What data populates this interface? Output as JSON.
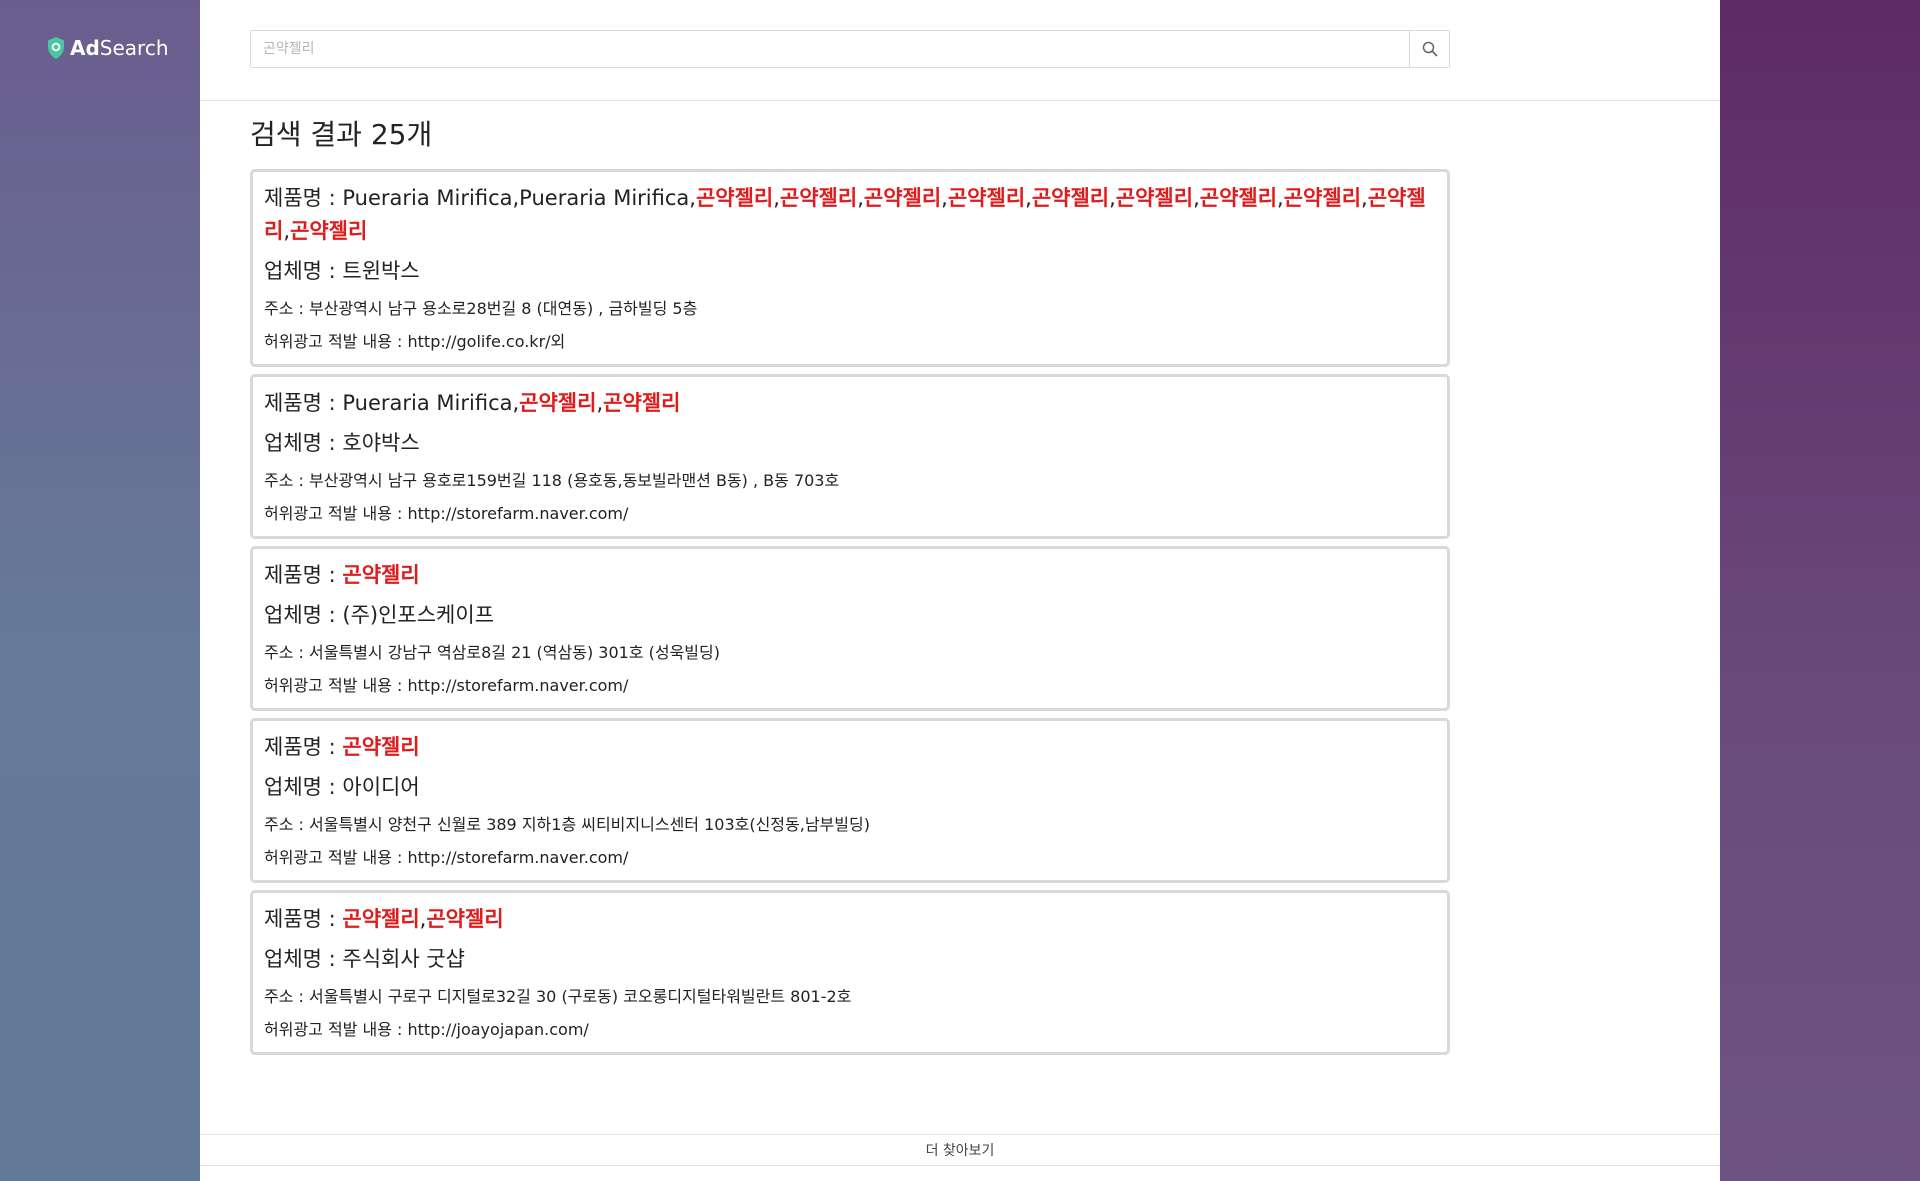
{
  "brand": {
    "name_bold": "Ad",
    "name_rest": "Search",
    "logo_icon": "shield-icon",
    "logo_color": "#4cc5a0"
  },
  "search": {
    "placeholder": "곤약젤리",
    "value": "",
    "button_icon": "search-icon"
  },
  "results_header": "검색 결과 25개",
  "labels": {
    "product": "제품명 : ",
    "company": "업체명 : ",
    "address": "주소 : ",
    "violation": "허위광고 적발 내용 : "
  },
  "results": [
    {
      "product_parts": [
        {
          "text": "Pueraria Mirifica,Pueraria Mirifica,",
          "hl": false
        },
        {
          "text": "곤약젤리",
          "hl": true
        },
        {
          "text": ",",
          "hl": false
        },
        {
          "text": "곤약젤리",
          "hl": true
        },
        {
          "text": ",",
          "hl": false
        },
        {
          "text": "곤약젤리",
          "hl": true
        },
        {
          "text": ",",
          "hl": false
        },
        {
          "text": "곤약젤리",
          "hl": true
        },
        {
          "text": ",",
          "hl": false
        },
        {
          "text": "곤약젤리",
          "hl": true
        },
        {
          "text": ",",
          "hl": false
        },
        {
          "text": "곤약젤리",
          "hl": true
        },
        {
          "text": ",",
          "hl": false
        },
        {
          "text": "곤약젤리",
          "hl": true
        },
        {
          "text": ",",
          "hl": false
        },
        {
          "text": "곤약젤리",
          "hl": true
        },
        {
          "text": ",",
          "hl": false
        },
        {
          "text": "곤약젤리",
          "hl": true
        },
        {
          "text": ",",
          "hl": false
        },
        {
          "text": "곤약젤리",
          "hl": true
        }
      ],
      "company": "트윈박스",
      "address": "부산광역시 남구 용소로28번길 8 (대연동) , 금하빌딩 5층",
      "violation": "http://golife.co.kr/외"
    },
    {
      "product_parts": [
        {
          "text": "Pueraria Mirifica,",
          "hl": false
        },
        {
          "text": "곤약젤리",
          "hl": true
        },
        {
          "text": ",",
          "hl": false
        },
        {
          "text": "곤약젤리",
          "hl": true
        }
      ],
      "company": "호야박스",
      "address": "부산광역시 남구 용호로159번길 118 (용호동,동보빌라맨션 B동) , B동 703호",
      "violation": "http://storefarm.naver.com/"
    },
    {
      "product_parts": [
        {
          "text": "곤약젤리",
          "hl": true
        }
      ],
      "company": "(주)인포스케이프",
      "address": "서울특별시 강남구 역삼로8길 21 (역삼동) 301호 (성욱빌딩)",
      "violation": "http://storefarm.naver.com/"
    },
    {
      "product_parts": [
        {
          "text": "곤약젤리",
          "hl": true
        }
      ],
      "company": "아이디어",
      "address": "서울특별시 양천구 신월로 389 지하1층 씨티비지니스센터 103호(신정동,남부빌딩)",
      "violation": "http://storefarm.naver.com/"
    },
    {
      "product_parts": [
        {
          "text": "곤약젤리",
          "hl": true
        },
        {
          "text": ",",
          "hl": false
        },
        {
          "text": "곤약젤리",
          "hl": true
        }
      ],
      "company": "주식회사 굿샵",
      "address": "서울특별시 구로구 디지털로32길 30 (구로동) 코오롱디지털타워빌란트 801-2호",
      "violation": "http://joayojapan.com/"
    }
  ],
  "more_button": "더 찾아보기",
  "colors": {
    "highlight": "#e01b1b",
    "card_border": "#d9d9d9",
    "left_panel": "#667a9a",
    "right_panel": "#5e2a66"
  }
}
